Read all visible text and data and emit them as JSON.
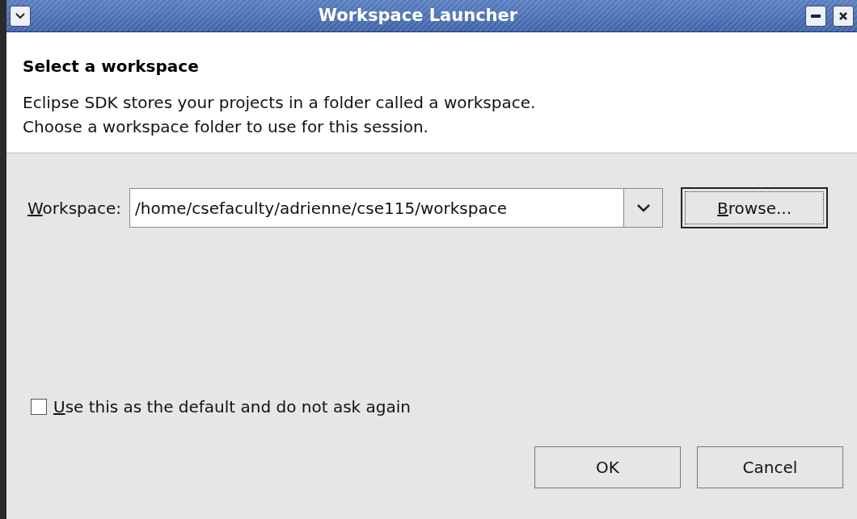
{
  "window": {
    "title": "Workspace Launcher"
  },
  "header": {
    "title": "Select a workspace",
    "description": [
      "Eclipse SDK stores your projects in a folder called a workspace.",
      "Choose a workspace folder to use for this session."
    ]
  },
  "workspace": {
    "label": "Workspace:",
    "value": "/home/csefaculty/adrienne/cse115/workspace",
    "browse": "Browse..."
  },
  "default_checkbox": {
    "label": "Use this as the default and do not ask again",
    "checked": false
  },
  "buttons": [
    "OK",
    "Cancel"
  ]
}
